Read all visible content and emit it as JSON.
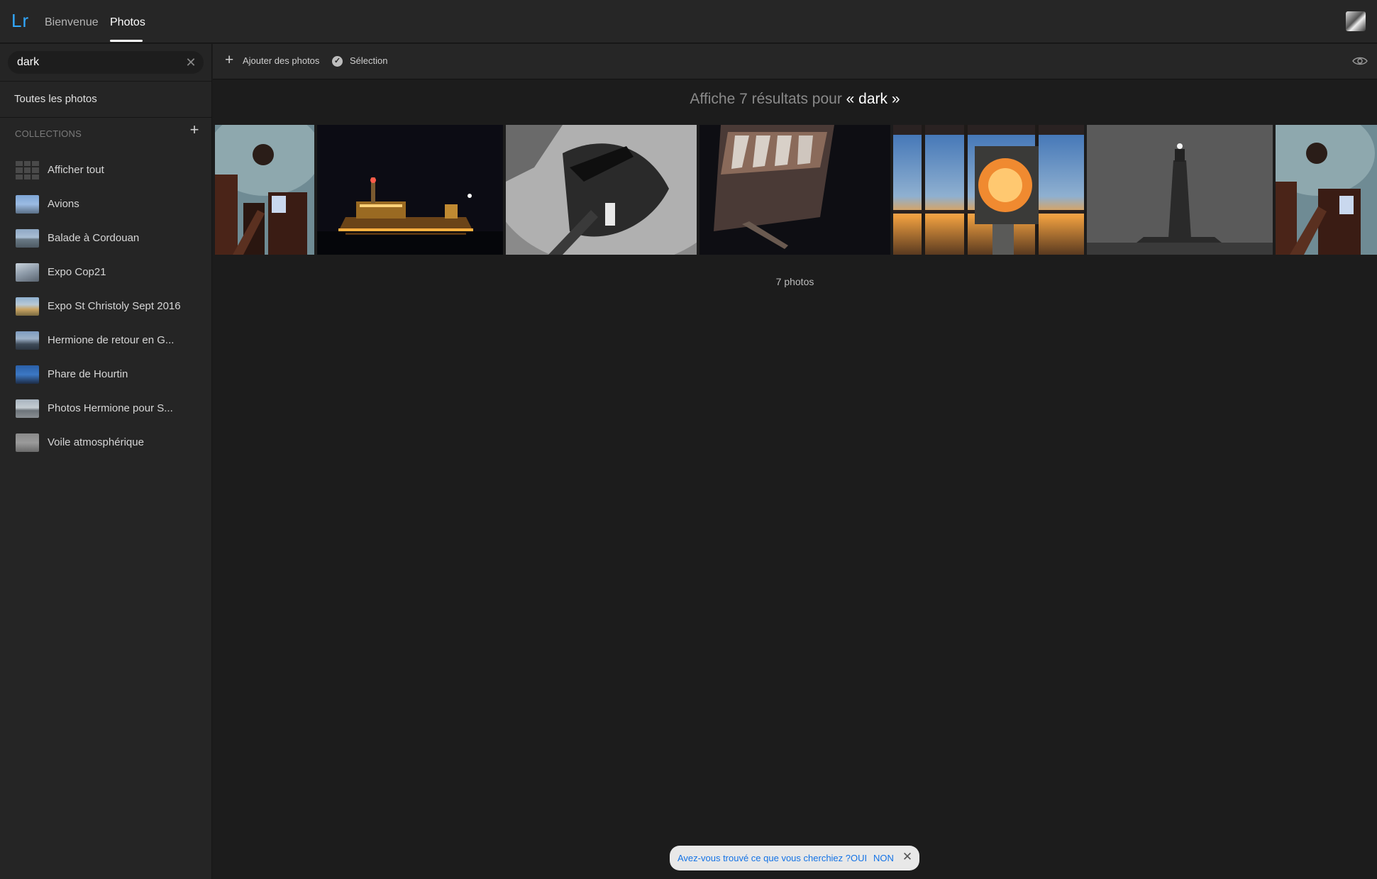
{
  "app": {
    "logo": "Lr"
  },
  "nav": {
    "tabs": [
      {
        "label": "Bienvenue"
      },
      {
        "label": "Photos",
        "active": true
      }
    ]
  },
  "search": {
    "value": "dark"
  },
  "sidebar": {
    "all_photos": "Toutes les photos",
    "collections_header": "COLLECTIONS",
    "collections": [
      {
        "label": "Afficher tout",
        "icon": "grid-icon"
      },
      {
        "label": "Avions"
      },
      {
        "label": "Balade à Cordouan"
      },
      {
        "label": "Expo Cop21"
      },
      {
        "label": "Expo St Christoly Sept 2016"
      },
      {
        "label": "Hermione de retour en G..."
      },
      {
        "label": "Phare de Hourtin"
      },
      {
        "label": "Photos Hermione pour S..."
      },
      {
        "label": "Voile atmosphérique"
      }
    ]
  },
  "toolbar": {
    "add_label": "Ajouter des photos",
    "select_label": "Sélection"
  },
  "results": {
    "prefix": "Affiche 7 résultats pour",
    "query": "« dark »",
    "count_label": "7 photos"
  },
  "feedback": {
    "question": "Avez-vous trouvé ce que vous cherchiez ?",
    "yes": "OUI",
    "no": "NON"
  },
  "colors": {
    "accent": "#31a8ff",
    "background": "#1c1c1c",
    "panel": "#252525",
    "link": "#1473e6"
  }
}
